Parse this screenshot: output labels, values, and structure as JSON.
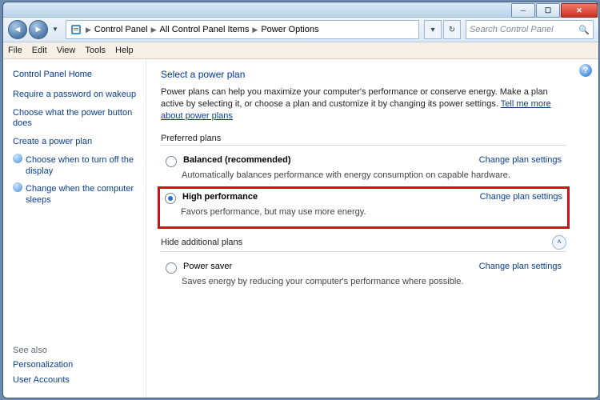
{
  "titlebar": {
    "min_tip": "Minimize",
    "max_tip": "Maximize",
    "close_tip": "Close"
  },
  "nav": {
    "back_tip": "Back",
    "forward_tip": "Forward",
    "breadcrumb_icon": "control-panel",
    "crumbs": [
      "Control Panel",
      "All Control Panel Items",
      "Power Options"
    ],
    "refresh_tip": "Refresh",
    "search_placeholder": "Search Control Panel"
  },
  "menu": {
    "items": [
      "File",
      "Edit",
      "View",
      "Tools",
      "Help"
    ]
  },
  "sidebar": {
    "home": "Control Panel Home",
    "links": [
      "Require a password on wakeup",
      "Choose what the power button does",
      "Create a power plan",
      "Choose when to turn off the display",
      "Change when the computer sleeps"
    ],
    "seealso_title": "See also",
    "seealso": [
      "Personalization",
      "User Accounts"
    ]
  },
  "content": {
    "heading": "Select a power plan",
    "intro_a": "Power plans can help you maximize your computer's performance or conserve energy. Make a plan active by selecting it, or choose a plan and customize it by changing its power settings. ",
    "intro_link": "Tell me more about power plans",
    "preferred_label": "Preferred plans",
    "plans": [
      {
        "name": "Balanced (recommended)",
        "desc": "Automatically balances performance with energy consumption on capable hardware.",
        "selected": false,
        "change": "Change plan settings",
        "highlight": false
      },
      {
        "name": "High performance",
        "desc": "Favors performance, but may use more energy.",
        "selected": true,
        "change": "Change plan settings",
        "highlight": true
      }
    ],
    "hide_label": "Hide additional plans",
    "extra": {
      "name": "Power saver",
      "desc": "Saves energy by reducing your computer's performance where possible.",
      "selected": false,
      "change": "Change plan settings"
    },
    "help_tip": "Get help"
  }
}
